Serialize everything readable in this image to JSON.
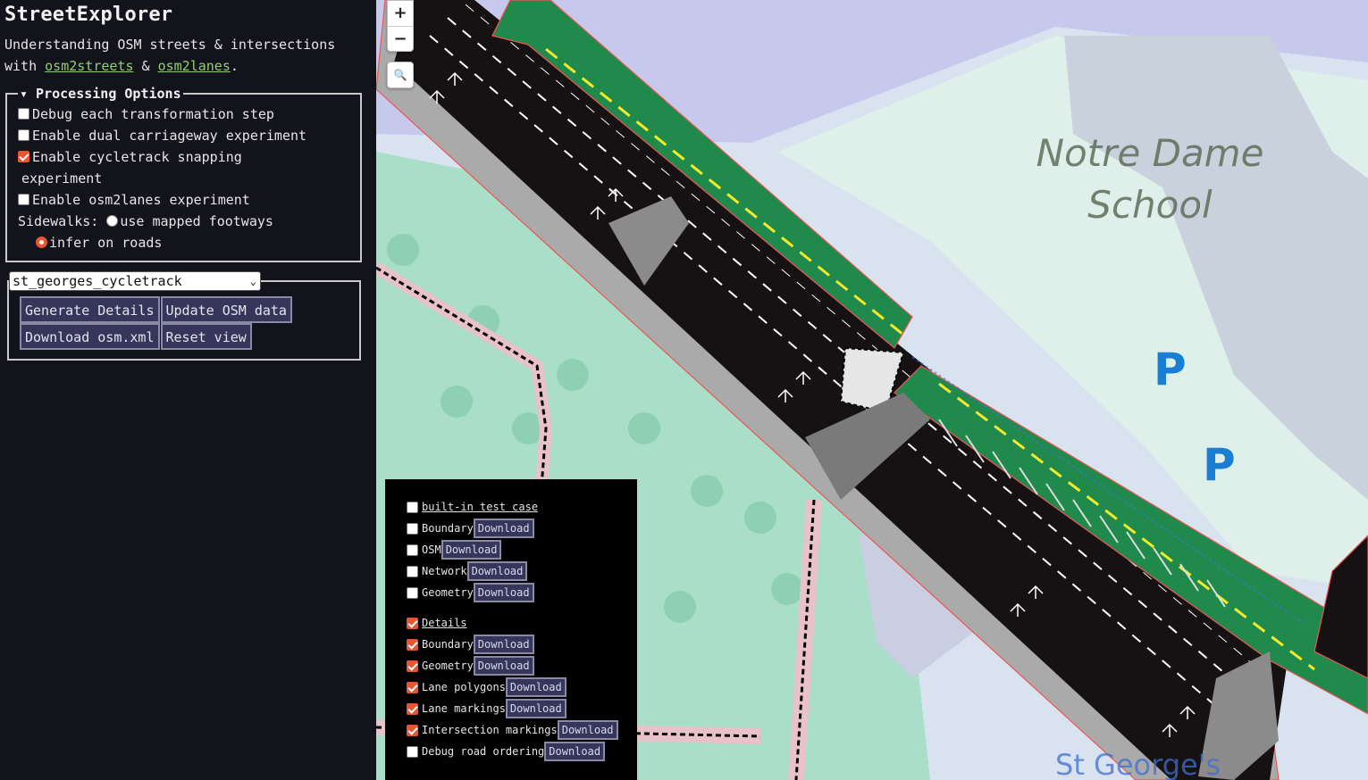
{
  "app": {
    "title": "StreetExplorer",
    "subtitle_line1": "Understanding OSM streets & intersections",
    "subtitle_with": "with ",
    "link1": "osm2streets",
    "amp": " & ",
    "link2": "osm2lanes",
    "period": "."
  },
  "processing": {
    "legend": "▾ Processing Options",
    "debug_steps": "Debug each transformation step",
    "dual_carriageway": "Enable dual carriageway experiment",
    "cycletrack_snapping": "Enable cycletrack snapping",
    "cycletrack_snapping_cont": "experiment",
    "osm2lanes": "Enable osm2lanes experiment",
    "sidewalks_label": "Sidewalks:",
    "sidewalks_opt1": "use mapped footways",
    "sidewalks_opt2": "infer on roads"
  },
  "controls": {
    "selected_test": "st_georges_cycletrack",
    "generate": "Generate Details",
    "update_osm": "Update OSM data",
    "download_osm": "Download osm.xml",
    "reset_view": "Reset view"
  },
  "map": {
    "zoom_in": "+",
    "zoom_out": "−",
    "search": "🔍",
    "school_label_1": "Notre Dame",
    "school_label_2": "School",
    "street_label": "St George's",
    "parking_letter": "P",
    "parking_bike": "⚲⚲"
  },
  "layers": {
    "download": "Download",
    "test_case": "built-in test case",
    "tc_items": [
      "Boundary",
      "OSM",
      "Network",
      "Geometry"
    ],
    "details": "Details",
    "det_items": [
      "Boundary",
      "Geometry",
      "Lane polygons",
      "Lane markings",
      "Intersection markings",
      "Debug road ordering"
    ]
  },
  "colors": {
    "accent": "#e8552e",
    "link": "#8fd26b",
    "button_bg": "#36365a",
    "cycletrack": "#1f8a4c",
    "road": "#161213",
    "park": "#a9dfc8"
  }
}
